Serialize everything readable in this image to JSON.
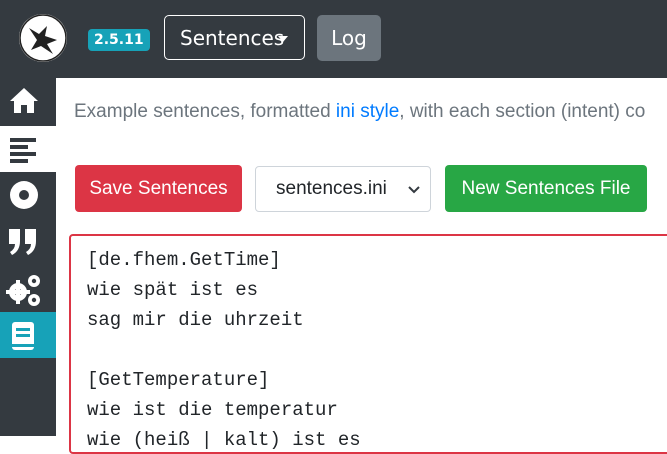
{
  "header": {
    "logo_name": "rhasspy-logo",
    "version": "2.5.11",
    "dropdown_label": "Sentences",
    "log_label": "Log"
  },
  "sidebar": {
    "items": [
      {
        "icon": "home-icon",
        "state": "normal"
      },
      {
        "icon": "align-left-icon",
        "state": "active"
      },
      {
        "icon": "record-icon",
        "state": "normal"
      },
      {
        "icon": "quote-icon",
        "state": "normal"
      },
      {
        "icon": "cogs-icon",
        "state": "normal"
      },
      {
        "icon": "book-icon",
        "state": "highlight"
      }
    ]
  },
  "main": {
    "description_prefix": "Example sentences, formatted ",
    "description_link": "ini style",
    "description_suffix": ", with each section (intent) co",
    "save_label": "Save Sentences",
    "file_select_value": "sentences.ini",
    "new_file_label": "New Sentences File",
    "editor_lines": [
      "[de.fhem.GetTime]",
      "wie spät ist es",
      "sag mir die uhrzeit",
      "",
      "[GetTemperature]",
      "wie ist die temperatur",
      "wie (heiß | kalt) ist es"
    ]
  },
  "colors": {
    "topbar": "#343a40",
    "badge": "#17a2b8",
    "danger": "#dc3545",
    "success": "#28a745",
    "link": "#007bff"
  }
}
